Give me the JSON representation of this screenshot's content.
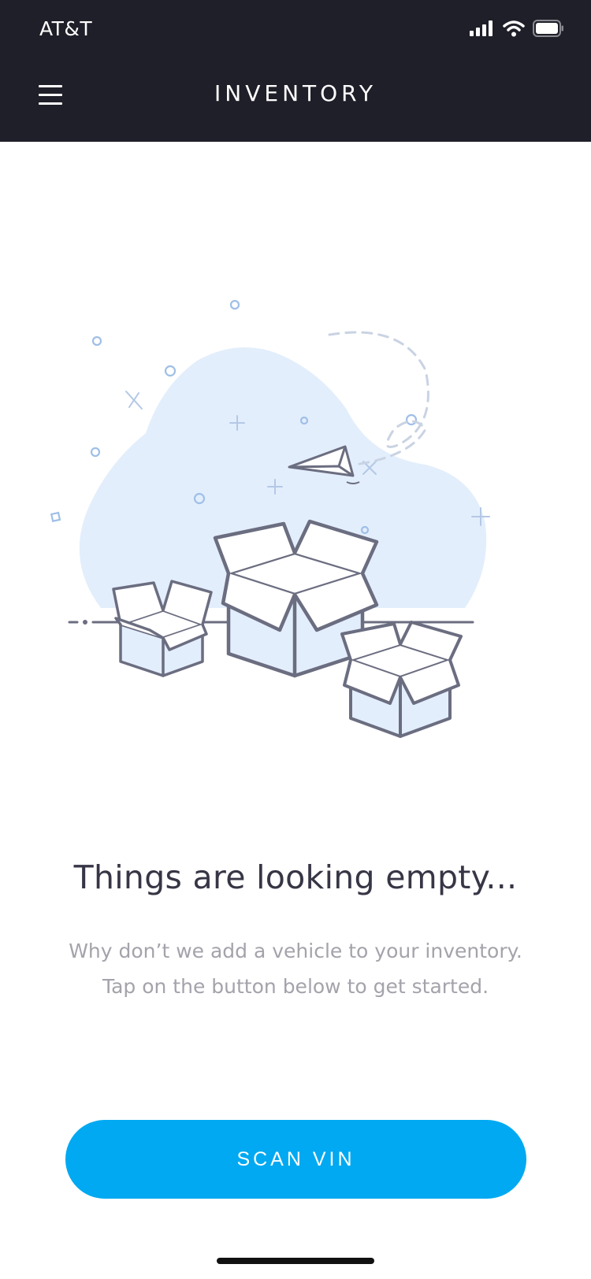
{
  "status_bar": {
    "carrier": "AT&T",
    "icons": [
      "signal-icon",
      "wifi-icon",
      "battery-icon"
    ]
  },
  "header": {
    "menu_icon": "hamburger-menu-icon",
    "title": "INVENTORY"
  },
  "empty_state": {
    "illustration": "empty-boxes-illustration",
    "headline": "Things are looking empty...",
    "message_line1": "Why don’t we add a vehicle to your inventory.",
    "message_line2": "Tap on the button below to get started."
  },
  "actions": {
    "scan_vin_label": "SCAN VIN"
  },
  "colors": {
    "header_bg": "#1f1f29",
    "accent": "#00a9f1",
    "blob": "#e3eefc",
    "line_art": "#6b6d80",
    "headline": "#363646",
    "muted_text": "#a3a3ab"
  }
}
